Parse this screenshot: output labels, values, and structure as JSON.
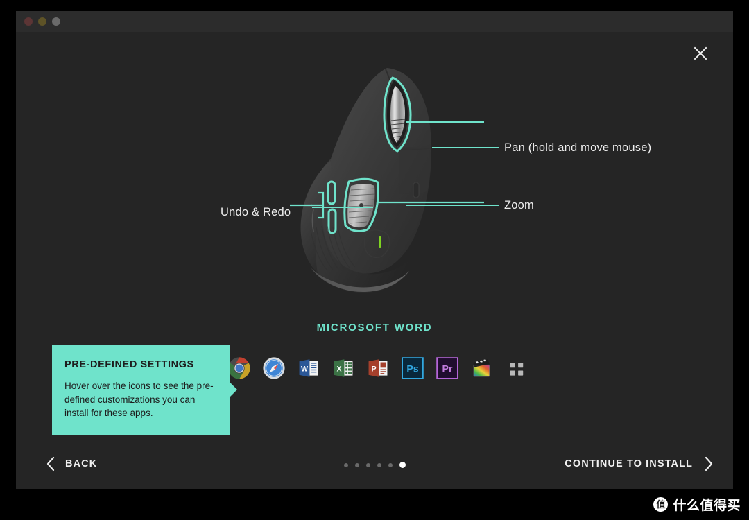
{
  "window": {
    "traffic_lights": [
      {
        "name": "close",
        "color": "#5c3535"
      },
      {
        "name": "minimize",
        "color": "#5e5327"
      },
      {
        "name": "maximize",
        "color": "#6a6a6a"
      }
    ],
    "background": "#252525",
    "titlebar_background": "#2c2c2c"
  },
  "accent": {
    "teal": "#6fe3cb",
    "text": "#efefef"
  },
  "close_button": {
    "icon": "close-icon"
  },
  "device": {
    "name": "Logitech MX Master 3 mouse",
    "callouts": [
      {
        "id": "pan",
        "label": "Pan (hold and move mouse)",
        "side": "right"
      },
      {
        "id": "zoom",
        "label": "Zoom",
        "side": "right"
      },
      {
        "id": "undo",
        "label": "Undo & Redo",
        "side": "left"
      }
    ]
  },
  "app_title": "MICROSOFT WORD",
  "tooltip": {
    "title": "PRE-DEFINED SETTINGS",
    "body": "Hover over the icons to see the pre-defined customizations you can install for these apps.",
    "background": "#6fe3cb",
    "text_color": "#1d1d1d"
  },
  "apps": [
    {
      "name": "Google Chrome",
      "icon": "chrome-icon"
    },
    {
      "name": "Safari",
      "icon": "safari-icon"
    },
    {
      "name": "Microsoft Word",
      "icon": "word-icon"
    },
    {
      "name": "Microsoft Excel",
      "icon": "excel-icon"
    },
    {
      "name": "Microsoft PowerPoint",
      "icon": "powerpoint-icon"
    },
    {
      "name": "Adobe Photoshop",
      "icon": "photoshop-icon"
    },
    {
      "name": "Adobe Premiere Pro",
      "icon": "premiere-icon"
    },
    {
      "name": "Final Cut Pro",
      "icon": "finalcut-icon"
    },
    {
      "name": "More apps",
      "icon": "grid-icon"
    }
  ],
  "app_labels": {
    "photoshop": "Ps",
    "premiere": "Pr",
    "word": "W",
    "excel": "X",
    "powerpoint": "P"
  },
  "footer": {
    "back_label": "BACK",
    "continue_label": "CONTINUE TO INSTALL",
    "pagination": {
      "total": 6,
      "active_index": 5
    }
  },
  "watermark": {
    "logo_char": "值",
    "text": "什么值得买"
  }
}
